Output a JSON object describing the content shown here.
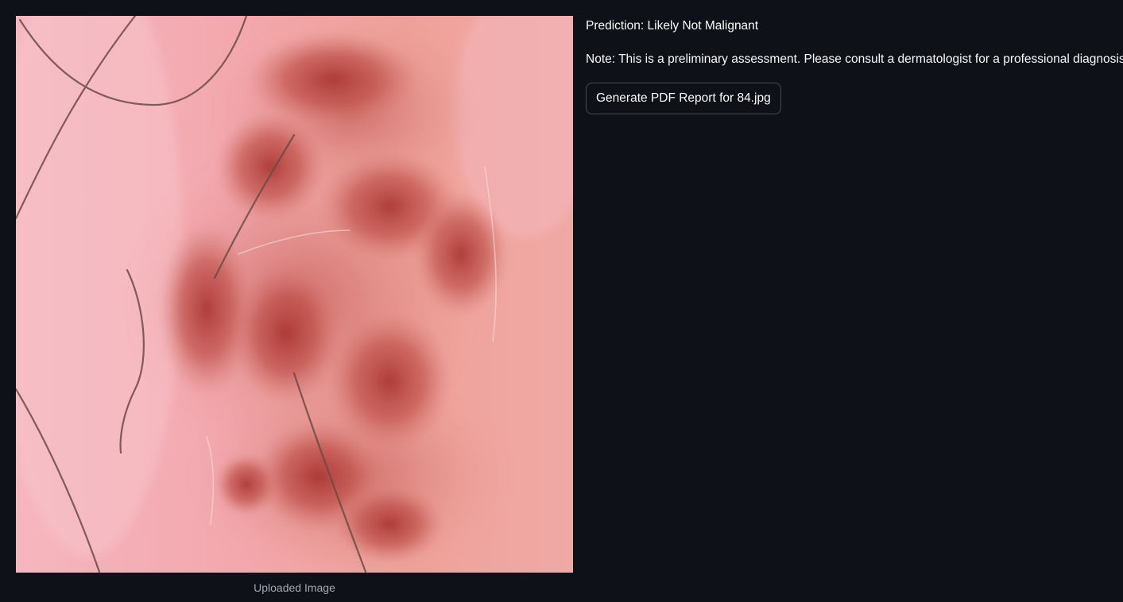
{
  "image": {
    "caption": "Uploaded Image",
    "colors": {
      "skin": "#f2a0a8",
      "skin_light": "#f7c0c6",
      "lesion": "#b5423f",
      "lesion_dark": "#9a2f2c",
      "hair": "#6b4a44"
    }
  },
  "result": {
    "prediction": "Prediction: Likely Not Malignant",
    "note": "Note: This is a preliminary assessment. Please consult a dermatologist for a professional diagnosis.",
    "report_button_label": "Generate PDF Report for 84.jpg"
  },
  "theme": {
    "background": "#0e1117",
    "text": "#fafafa",
    "caption": "#a3a8b4"
  }
}
